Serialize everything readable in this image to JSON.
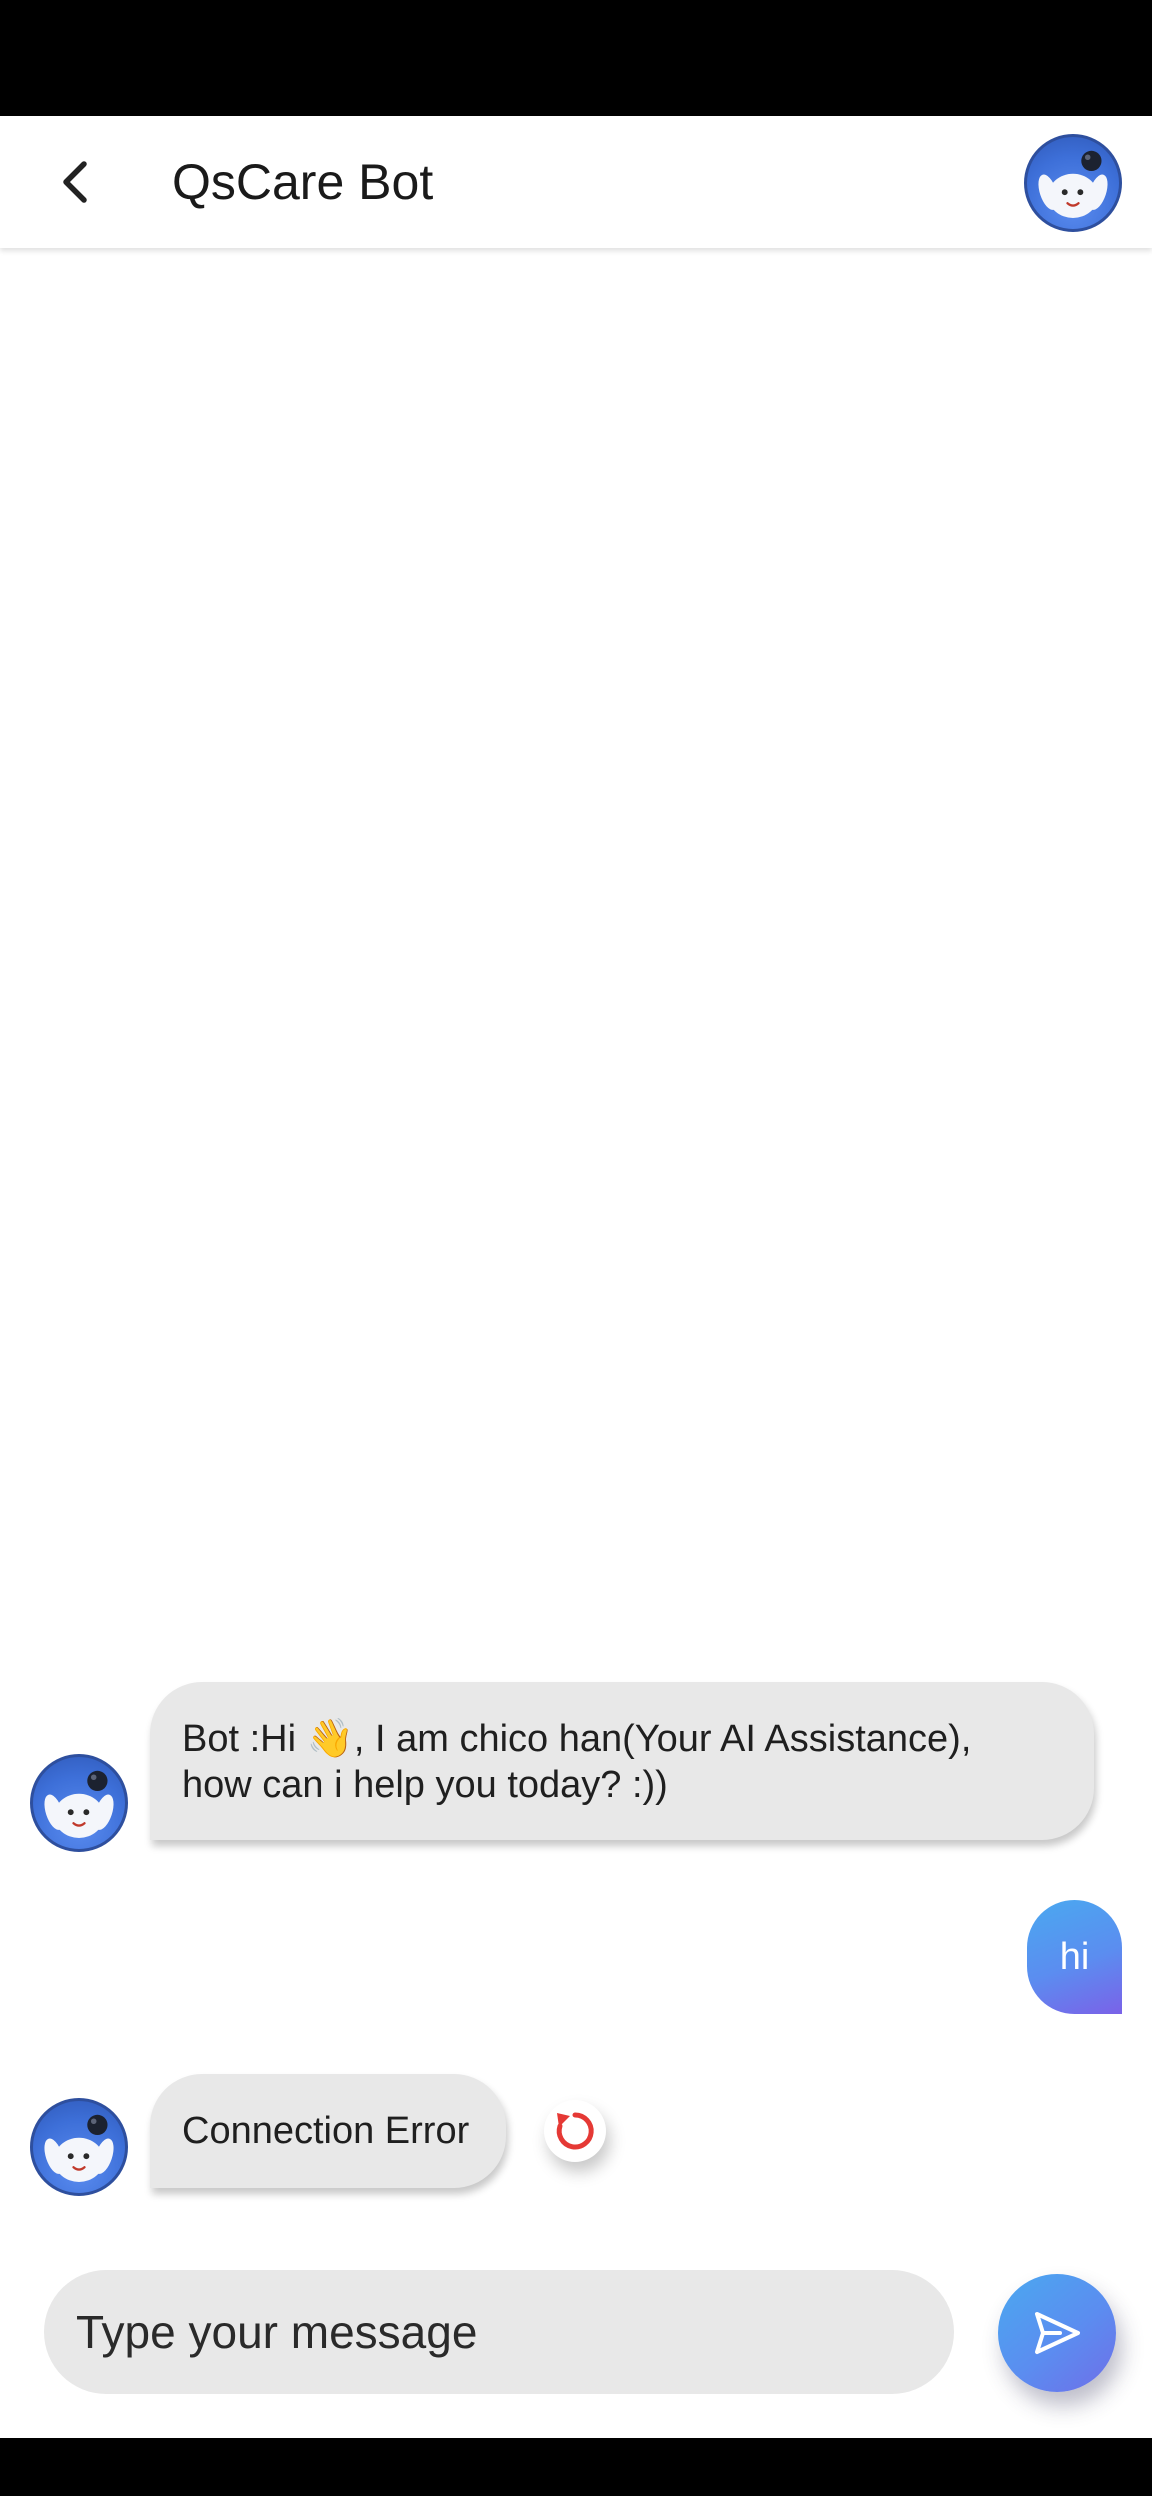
{
  "app_bar": {
    "title": "QsCare Bot",
    "back_icon": "chevron-left-icon",
    "avatar": "bot-mascot-avatar"
  },
  "messages": [
    {
      "sender": "bot",
      "text_line1": "Bot :Hi 👋, I am chico han(Your AI Assistance),",
      "text_line2": "how can i help you today? :))"
    },
    {
      "sender": "user",
      "text": "hi"
    },
    {
      "sender": "bot",
      "text": "Connection Error",
      "status_icon": "retry-icon"
    }
  ],
  "composer": {
    "placeholder": "Type your message",
    "value": "",
    "send_icon": "send-icon"
  },
  "colors": {
    "bubble_bot": "#e8e8e8",
    "gradient_start": "#4aa9f0",
    "gradient_end": "#7a62e8",
    "retry_icon": "#e53935",
    "avatar_blue": "#3d6fd8"
  }
}
